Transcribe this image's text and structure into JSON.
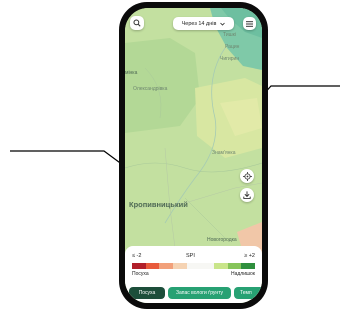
{
  "app": {
    "top_bar": {
      "search_icon": "search-icon",
      "period_selector": {
        "value": "Через 14 днів",
        "icon": "chevron-down-icon"
      },
      "menu_icon": "hamburger-menu-icon"
    },
    "map": {
      "labels": [
        {
          "text": "Тишкі",
          "style": "small"
        },
        {
          "text": "Рацин",
          "style": "small"
        },
        {
          "text": "Чигирин",
          "style": "small"
        },
        {
          "text": "Олександрівка",
          "style": "small"
        },
        {
          "text": "Знам'янка",
          "style": "small"
        },
        {
          "text": "Кропивницький",
          "style": "big"
        },
        {
          "text": "Новогородка",
          "style": "small"
        },
        {
          "text": "мінка",
          "style": "small"
        }
      ],
      "controls": {
        "locate_icon": "crosshair-icon",
        "download_icon": "download-icon"
      }
    },
    "legend": {
      "min_label": "≤ -2",
      "title": "SPI",
      "max_label": "≥ +2",
      "dry_label": "Посуха",
      "wet_label": "Надлишок",
      "scale_colors": [
        "#b11f2a",
        "#e85a3b",
        "#f2a07a",
        "#f5d3b3",
        "#f7f7f4",
        "#f7f7f4",
        "#c9e58a",
        "#86c459",
        "#2f8f3d"
      ]
    },
    "tabs": [
      {
        "label": "Посуха",
        "active": true
      },
      {
        "label": "Запас вологи ґрунту",
        "active": false
      },
      {
        "label": "Темп",
        "active": false
      }
    ],
    "colors": {
      "active_tab": "#1c4e3a",
      "tab": "#27a173",
      "phone_frame": "#0b0b0b"
    }
  }
}
